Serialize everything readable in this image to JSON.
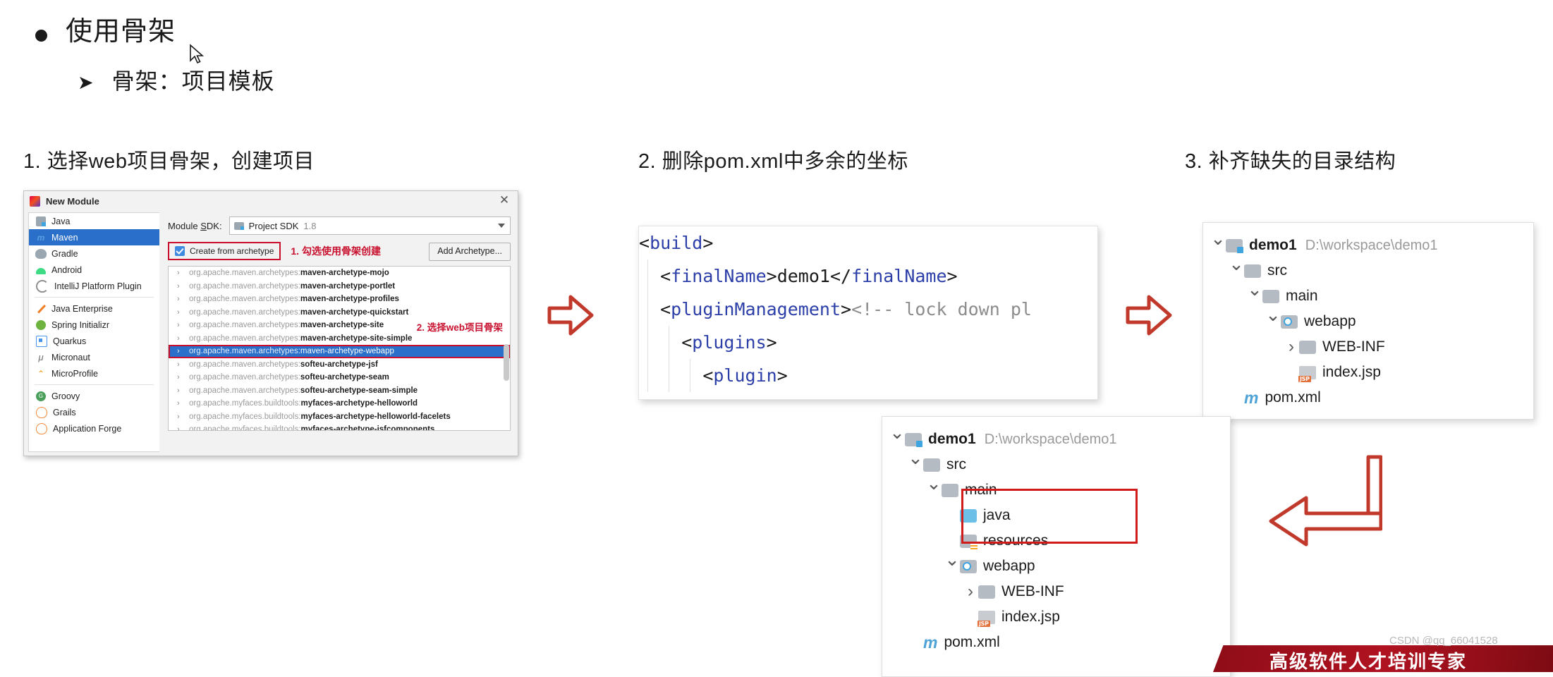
{
  "slide": {
    "bullet_level1": "使用骨架",
    "bullet_level2": "骨架：项目模板",
    "captions": {
      "step1": "1. 选择web项目骨架，创建项目",
      "step2": "2. 删除pom.xml中多余的坐标",
      "step3": "3. 补齐缺失的目录结构"
    }
  },
  "dialog": {
    "title": "New Module",
    "close_label": "✕",
    "sidebar_items": [
      {
        "label": "Java",
        "icon": "java-module-icon",
        "selected": false
      },
      {
        "label": "Maven",
        "icon": "maven-icon",
        "selected": true
      },
      {
        "label": "Gradle",
        "icon": "gradle-icon",
        "selected": false
      },
      {
        "label": "Android",
        "icon": "android-icon",
        "selected": false
      },
      {
        "label": "IntelliJ Platform Plugin",
        "icon": "intellij-plugin-icon",
        "selected": false
      },
      {
        "label": "Java Enterprise",
        "icon": "java-enterprise-icon",
        "selected": false
      },
      {
        "label": "Spring Initializr",
        "icon": "spring-icon",
        "selected": false
      },
      {
        "label": "Quarkus",
        "icon": "quarkus-icon",
        "selected": false
      },
      {
        "label": "Micronaut",
        "icon": "micronaut-icon",
        "selected": false
      },
      {
        "label": "MicroProfile",
        "icon": "microprofile-icon",
        "selected": false
      },
      {
        "label": "Groovy",
        "icon": "groovy-icon",
        "selected": false
      },
      {
        "label": "Grails",
        "icon": "grails-icon",
        "selected": false
      },
      {
        "label": "Application Forge",
        "icon": "forge-icon",
        "selected": false
      }
    ],
    "sdk_label": "Module SDK:",
    "sdk_value": "Project SDK",
    "sdk_version": "1.8",
    "create_from_archetype_label": "Create from archetype",
    "add_archetype_button": "Add Archetype...",
    "annotation_checkbox": "1. 勾选使用骨架创建",
    "annotation_archetype": "2. 选择web项目骨架",
    "archetypes": [
      {
        "group": "org.apache.maven.archetypes:",
        "artifact": "maven-archetype-mojo",
        "selected": false
      },
      {
        "group": "org.apache.maven.archetypes:",
        "artifact": "maven-archetype-portlet",
        "selected": false
      },
      {
        "group": "org.apache.maven.archetypes:",
        "artifact": "maven-archetype-profiles",
        "selected": false
      },
      {
        "group": "org.apache.maven.archetypes:",
        "artifact": "maven-archetype-quickstart",
        "selected": false
      },
      {
        "group": "org.apache.maven.archetypes:",
        "artifact": "maven-archetype-site",
        "selected": false
      },
      {
        "group": "org.apache.maven.archetypes:",
        "artifact": "maven-archetype-site-simple",
        "selected": false
      },
      {
        "group": "org.apache.maven.archetypes:",
        "artifact": "maven-archetype-webapp",
        "selected": true
      },
      {
        "group": "org.apache.maven.archetypes:",
        "artifact": "softeu-archetype-jsf",
        "selected": false
      },
      {
        "group": "org.apache.maven.archetypes:",
        "artifact": "softeu-archetype-seam",
        "selected": false
      },
      {
        "group": "org.apache.maven.archetypes:",
        "artifact": "softeu-archetype-seam-simple",
        "selected": false
      },
      {
        "group": "org.apache.myfaces.buildtools:",
        "artifact": "myfaces-archetype-helloworld",
        "selected": false
      },
      {
        "group": "org.apache.myfaces.buildtools:",
        "artifact": "myfaces-archetype-helloworld-facelets",
        "selected": false
      },
      {
        "group": "org.apache.myfaces.buildtools:",
        "artifact": "myfaces-archetype-jsfcomponents",
        "selected": false
      }
    ]
  },
  "code": {
    "lines": [
      {
        "indent": 0,
        "parts": [
          {
            "t": "<",
            "c": "ang"
          },
          {
            "t": "build",
            "c": "tag"
          },
          {
            "t": ">",
            "c": "ang"
          }
        ]
      },
      {
        "indent": 1,
        "parts": [
          {
            "t": "<",
            "c": "ang"
          },
          {
            "t": "finalName",
            "c": "tag"
          },
          {
            "t": ">",
            "c": "ang"
          },
          {
            "t": "demo1",
            "c": "txtv"
          },
          {
            "t": "</",
            "c": "ang"
          },
          {
            "t": "finalName",
            "c": "tag"
          },
          {
            "t": ">",
            "c": "ang"
          }
        ]
      },
      {
        "indent": 1,
        "parts": [
          {
            "t": "<",
            "c": "ang"
          },
          {
            "t": "pluginManagement",
            "c": "tag"
          },
          {
            "t": ">",
            "c": "ang"
          },
          {
            "t": "<!-- lock down pl",
            "c": "cmt"
          }
        ]
      },
      {
        "indent": 2,
        "parts": [
          {
            "t": "<",
            "c": "ang"
          },
          {
            "t": "plugins",
            "c": "tag"
          },
          {
            "t": ">",
            "c": "ang"
          }
        ]
      },
      {
        "indent": 3,
        "parts": [
          {
            "t": "<",
            "c": "ang"
          },
          {
            "t": "plugin",
            "c": "tag"
          },
          {
            "t": ">",
            "c": "ang"
          }
        ]
      }
    ]
  },
  "tree_top": {
    "nodes": [
      {
        "depth": 0,
        "chev": "down",
        "icon": "module-folder-icon",
        "name": "demo1",
        "bold": true,
        "path": "D:\\workspace\\demo1"
      },
      {
        "depth": 1,
        "chev": "down",
        "icon": "folder-icon",
        "name": "src",
        "bold": false,
        "path": ""
      },
      {
        "depth": 2,
        "chev": "down",
        "icon": "folder-icon",
        "name": "main",
        "bold": false,
        "path": ""
      },
      {
        "depth": 3,
        "chev": "down",
        "icon": "webapp-folder-icon",
        "name": "webapp",
        "bold": false,
        "path": ""
      },
      {
        "depth": 4,
        "chev": "right",
        "icon": "folder-icon",
        "name": "WEB-INF",
        "bold": false,
        "path": ""
      },
      {
        "depth": 4,
        "chev": "none",
        "icon": "jsp-file-icon",
        "name": "index.jsp",
        "bold": false,
        "path": ""
      },
      {
        "depth": 1,
        "chev": "none",
        "icon": "maven-file-icon",
        "name": "pom.xml",
        "bold": false,
        "path": ""
      }
    ]
  },
  "tree_bottom": {
    "nodes": [
      {
        "depth": 0,
        "chev": "down",
        "icon": "module-folder-icon",
        "name": "demo1",
        "bold": true,
        "path": "D:\\workspace\\demo1"
      },
      {
        "depth": 1,
        "chev": "down",
        "icon": "folder-icon",
        "name": "src",
        "bold": false,
        "path": ""
      },
      {
        "depth": 2,
        "chev": "down",
        "icon": "folder-icon",
        "name": "main",
        "bold": false,
        "path": ""
      },
      {
        "depth": 3,
        "chev": "none",
        "icon": "source-folder-icon",
        "name": "java",
        "bold": false,
        "path": ""
      },
      {
        "depth": 3,
        "chev": "none",
        "icon": "resources-folder-icon",
        "name": "resources",
        "bold": false,
        "path": ""
      },
      {
        "depth": 3,
        "chev": "down",
        "icon": "webapp-folder-icon",
        "name": "webapp",
        "bold": false,
        "path": ""
      },
      {
        "depth": 4,
        "chev": "right",
        "icon": "folder-icon",
        "name": "WEB-INF",
        "bold": false,
        "path": ""
      },
      {
        "depth": 4,
        "chev": "none",
        "icon": "jsp-file-icon",
        "name": "index.jsp",
        "bold": false,
        "path": ""
      },
      {
        "depth": 1,
        "chev": "none",
        "icon": "maven-file-icon",
        "name": "pom.xml",
        "bold": false,
        "path": ""
      }
    ]
  },
  "watermark": {
    "band_text": "高级软件人才培训专家",
    "csdn": "CSDN @qq_66041528"
  },
  "colors": {
    "accent_red": "#c8102e",
    "selection_blue": "#2a6fc9",
    "code_blue": "#2b3fa0",
    "highlight_red": "#d01b1b"
  }
}
